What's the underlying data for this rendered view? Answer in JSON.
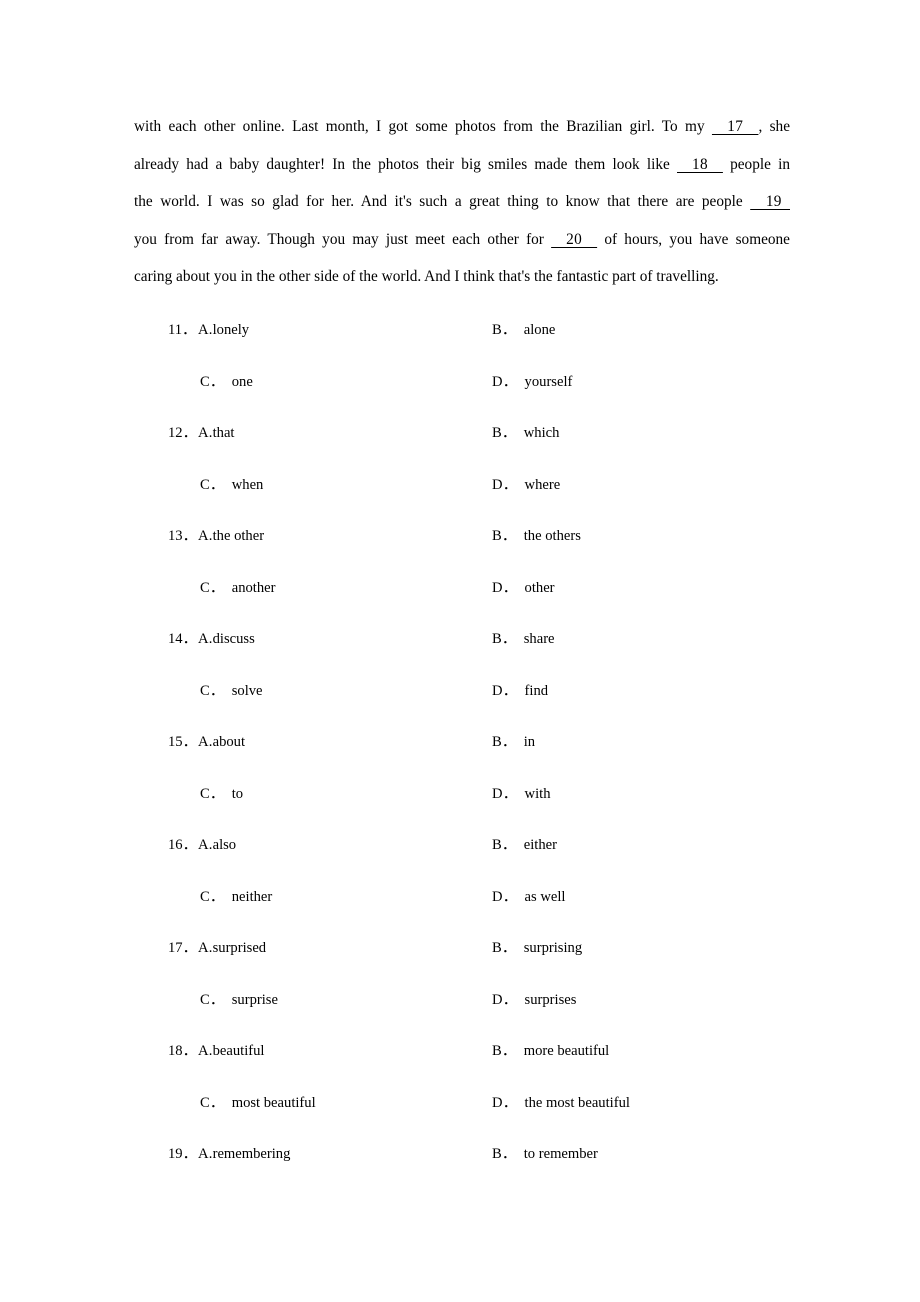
{
  "passage": {
    "lines": [
      {
        "id": "line-1",
        "parts": [
          {
            "type": "text",
            "text": "with each other online. Last month, I got some photos from the Brazilian girl. To my "
          },
          {
            "type": "blank",
            "text": "  17  "
          },
          {
            "type": "text",
            "text": ",    she"
          }
        ]
      },
      {
        "id": "line-2",
        "parts": [
          {
            "type": "text",
            "text": "already had a baby daughter! In the photos their big smiles made them look like "
          },
          {
            "type": "blank",
            "text": "  18  "
          },
          {
            "type": "text",
            "text": " people in"
          }
        ]
      },
      {
        "id": "line-3",
        "parts": [
          {
            "type": "text",
            "text": "the world. I was so glad for her. And it's such a great thing to know that there are people "
          },
          {
            "type": "blank",
            "text": "  19  "
          }
        ]
      },
      {
        "id": "line-4",
        "parts": [
          {
            "type": "text",
            "text": "you from far away. Though you may just meet each other for "
          },
          {
            "type": "blank",
            "text": "  20  "
          },
          {
            "type": "text",
            "text": " of hours, you have someone"
          }
        ]
      },
      {
        "id": "line-5",
        "parts": [
          {
            "type": "text",
            "text": "caring about you in the other side of the world. And I think that's the fantastic part of travelling."
          }
        ]
      }
    ]
  },
  "questions": [
    {
      "number": "11．",
      "a_label": "A.",
      "a_text": "lonely",
      "b_label": "B．",
      "b_text": "alone",
      "c_label": "C．",
      "c_text": "one",
      "d_label": "D．",
      "d_text": "yourself"
    },
    {
      "number": "12．",
      "a_label": "A.",
      "a_text": "that",
      "b_label": "B．",
      "b_text": "which",
      "c_label": "C．",
      "c_text": "when",
      "d_label": "D．",
      "d_text": "where"
    },
    {
      "number": "13．",
      "a_label": "A.",
      "a_text": "the other",
      "b_label": "B．",
      "b_text": "the others",
      "c_label": "C．",
      "c_text": "another",
      "d_label": "D．",
      "d_text": "other"
    },
    {
      "number": "14．",
      "a_label": "A.",
      "a_text": "discuss",
      "b_label": "B．",
      "b_text": "share",
      "c_label": "C．",
      "c_text": "solve",
      "d_label": "D．",
      "d_text": "find"
    },
    {
      "number": "15．",
      "a_label": "A.",
      "a_text": "about",
      "b_label": "B．",
      "b_text": "in",
      "c_label": "C．",
      "c_text": "to",
      "d_label": "D．",
      "d_text": "with"
    },
    {
      "number": "16．",
      "a_label": "A.",
      "a_text": "also",
      "b_label": "B．",
      "b_text": "either",
      "c_label": "C．",
      "c_text": "neither",
      "d_label": "D．",
      "d_text": "as well"
    },
    {
      "number": "17．",
      "a_label": "A.",
      "a_text": "surprised",
      "b_label": "B．",
      "b_text": "surprising",
      "c_label": "C．",
      "c_text": "surprise",
      "d_label": "D．",
      "d_text": "surprises"
    },
    {
      "number": "18．",
      "a_label": "A.",
      "a_text": "beautiful",
      "b_label": "B．",
      "b_text": "more beautiful",
      "c_label": "C．",
      "c_text": "most beautiful",
      "d_label": "D．",
      "d_text": "the most beautiful"
    },
    {
      "number": "19．",
      "a_label": "A.",
      "a_text": "remembering",
      "b_label": "B．",
      "b_text": "to remember",
      "c_label": "",
      "c_text": "",
      "d_label": "",
      "d_text": ""
    }
  ]
}
